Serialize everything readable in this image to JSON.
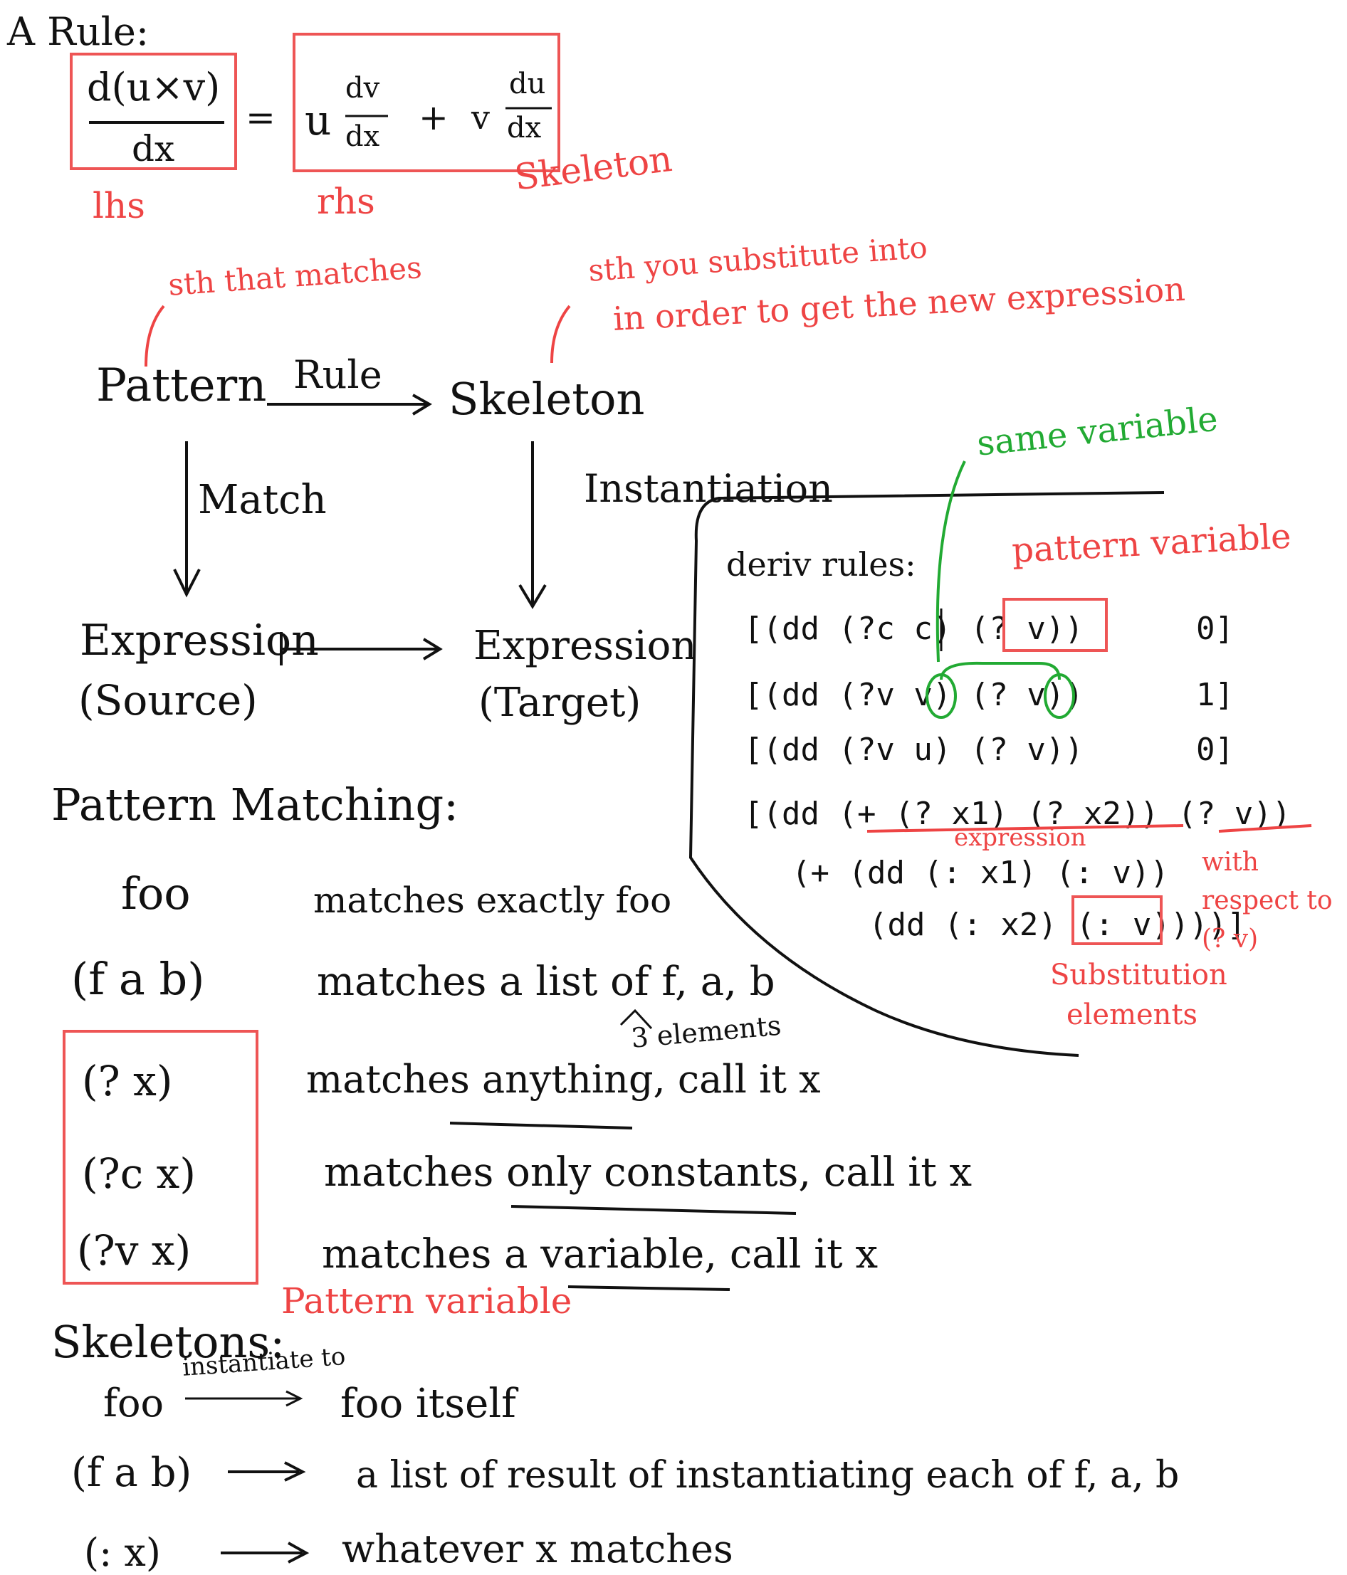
{
  "colors": {
    "ink": "#111111",
    "annotation": "#ee4444",
    "green": "#22aa33"
  },
  "rule": {
    "title": "A Rule:",
    "lhs_num": "d(u×v)",
    "lhs_den": "dx",
    "equals": "=",
    "rhs_u": "u",
    "rhs_dv": "dv",
    "rhs_dx1": "dx",
    "rhs_plus": "+",
    "rhs_v": "v",
    "rhs_du": "du",
    "rhs_dx2": "dx",
    "lhs_label": "lhs",
    "rhs_label": "rhs",
    "skeleton_label": "Skeleton"
  },
  "flow": {
    "pattern_note": "sth that matches",
    "skeleton_note_1": "sth you substitute into",
    "skeleton_note_2": "in order to get the new expression",
    "pattern": "Pattern",
    "rule": "Rule",
    "skeleton": "Skeleton",
    "match": "Match",
    "instantiation": "Instantiation",
    "expression_source": "Expression",
    "source": "(Source)",
    "expression_target": "Expression",
    "target": "(Target)"
  },
  "deriv": {
    "same_variable": "same variable",
    "pattern_variable": "pattern variable",
    "title": "deriv rules:",
    "rows": [
      {
        "lhs": "[(dd  (?c  c)  (? v))",
        "rhs": "0]"
      },
      {
        "lhs": "[(dd  (?v  v)  (?  v))",
        "rhs": "1]"
      },
      {
        "lhs": "[(dd  (?v  u)  (?  v))",
        "rhs": "0]"
      },
      {
        "lhs": "[(dd  (+  (? x1)  (? x2))  (? v))",
        "rhs": ""
      }
    ],
    "expression_note": "expression",
    "line5": "(+  (dd  (: x1)  (: v))",
    "line6": "(dd  (: x2)  (: v))))]",
    "with_respect_to": "with respect to (? v)",
    "substitution_elements": "Substitution elements"
  },
  "matching": {
    "title": "Pattern Matching:",
    "rows": [
      {
        "pattern": "foo",
        "description": "matches exactly foo"
      },
      {
        "pattern": "(f a b)",
        "description": "matches a list of f, a, b"
      },
      {
        "pattern": "(? x)",
        "description": "matches anything, call it x"
      },
      {
        "pattern": "(?c x)",
        "description": "matches only constants, call it x"
      },
      {
        "pattern": "(?v x)",
        "description": "matches a variable, call it x"
      }
    ],
    "three_elements": "3 elements",
    "pattern_variable": "Pattern variable"
  },
  "skeletons": {
    "title": "Skeletons:",
    "rows": [
      {
        "input": "foo",
        "arrow_label": "instantiate to",
        "output": "foo itself"
      },
      {
        "input": "(f a b)",
        "output": "a list of result of instantiating each of f, a, b"
      },
      {
        "input": "(: x)",
        "output": "whatever x matches"
      }
    ]
  }
}
